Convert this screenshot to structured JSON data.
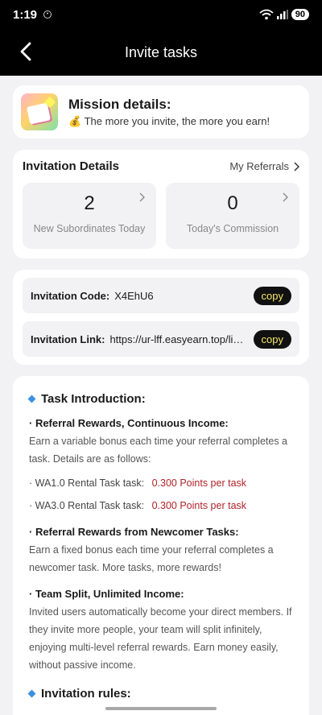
{
  "status": {
    "time": "1:19",
    "battery": "90"
  },
  "header": {
    "title": "Invite tasks"
  },
  "mission": {
    "title": "Mission details:",
    "subtitle": "💰 The more you invite, the more you earn!"
  },
  "invitation": {
    "title": "Invitation Details",
    "referrals_label": "My Referrals",
    "stats": [
      {
        "value": "2",
        "label": "New Subordinates Today"
      },
      {
        "value": "0",
        "label": "Today's Commission"
      }
    ]
  },
  "codes": {
    "code_label": "Invitation Code:",
    "code_value": "X4EhU6",
    "link_label": "Invitation Link:",
    "link_value": "https://ur-lff.easyearn.top/library",
    "copy_label": "copy"
  },
  "intro": {
    "title": "Task Introduction:",
    "referral_heading": "· Referral Rewards, Continuous Income:",
    "referral_text": "Earn a variable bonus each time your referral completes a task. Details are as follows:",
    "rates": [
      {
        "label": "· WA1.0 Rental Task task:",
        "value": "0.300 Points per task"
      },
      {
        "label": "· WA3.0 Rental Task task:",
        "value": "0.300 Points per task"
      }
    ],
    "newcomer_heading": "· Referral Rewards from Newcomer Tasks:",
    "newcomer_text": "Earn a fixed bonus each time your referral completes a newcomer task. More tasks, more rewards!",
    "team_heading": "· Team Split, Unlimited Income:",
    "team_text": "Invited users automatically become your direct members. If they invite more people, your team will split infinitely, enjoying multi-level referral rewards. Earn money easily, without passive income.",
    "rules_title": "Invitation rules:"
  },
  "colors": {
    "accent_red": "#b0232a",
    "copy_text": "#f5e66a",
    "diamond": "#3b8fe0"
  }
}
